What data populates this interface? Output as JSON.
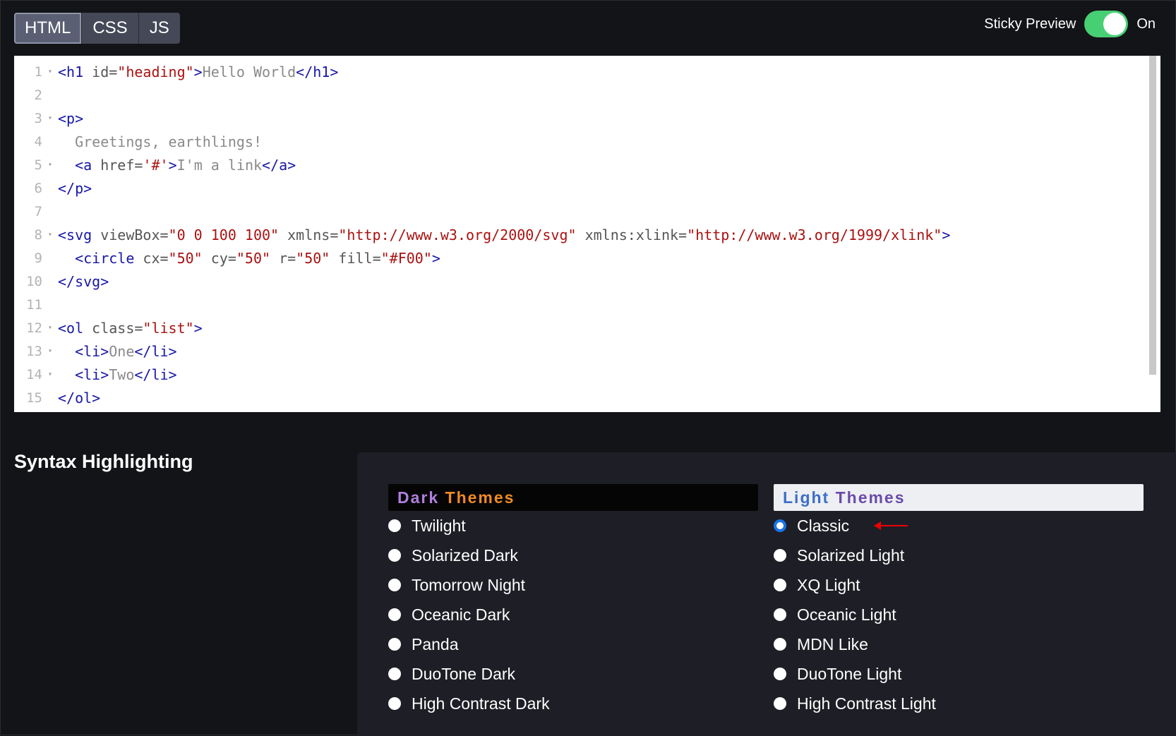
{
  "tabs": [
    "HTML",
    "CSS",
    "JS"
  ],
  "sticky_preview": {
    "label": "Sticky Preview",
    "state": "On"
  },
  "code_lines": [
    {
      "n": "1",
      "fold": "▾",
      "parts": [
        [
          "tag",
          "<h1 "
        ],
        [
          "attr",
          "id="
        ],
        [
          "str",
          "\"heading\""
        ],
        [
          "tag",
          ">"
        ],
        [
          "txt",
          "Hello World"
        ],
        [
          "tag",
          "</h1>"
        ]
      ]
    },
    {
      "n": "2",
      "fold": "",
      "parts": []
    },
    {
      "n": "3",
      "fold": "▾",
      "parts": [
        [
          "tag",
          "<p>"
        ]
      ]
    },
    {
      "n": "4",
      "fold": "",
      "parts": [
        [
          "txt",
          "  Greetings, earthlings!"
        ]
      ]
    },
    {
      "n": "5",
      "fold": "▾",
      "parts": [
        [
          "txt",
          "  "
        ],
        [
          "tag",
          "<a "
        ],
        [
          "attr",
          "href="
        ],
        [
          "str",
          "'#'"
        ],
        [
          "tag",
          ">"
        ],
        [
          "txt",
          "I'm a link"
        ],
        [
          "tag",
          "</a>"
        ]
      ]
    },
    {
      "n": "6",
      "fold": "",
      "parts": [
        [
          "tag",
          "</p>"
        ]
      ]
    },
    {
      "n": "7",
      "fold": "",
      "parts": []
    },
    {
      "n": "8",
      "fold": "▾",
      "parts": [
        [
          "tag",
          "<svg "
        ],
        [
          "attr",
          "viewBox="
        ],
        [
          "str",
          "\"0 0 100 100\""
        ],
        [
          "attr",
          " xmlns="
        ],
        [
          "str",
          "\"http://www.w3.org/2000/svg\""
        ],
        [
          "attr",
          " xmlns:xlink="
        ],
        [
          "str",
          "\"http://www.w3.org/1999/xlink\""
        ],
        [
          "tag",
          ">"
        ]
      ]
    },
    {
      "n": "9",
      "fold": "",
      "parts": [
        [
          "txt",
          "  "
        ],
        [
          "tag",
          "<circle "
        ],
        [
          "attr",
          "cx="
        ],
        [
          "str",
          "\"50\""
        ],
        [
          "attr",
          " cy="
        ],
        [
          "str",
          "\"50\""
        ],
        [
          "attr",
          " r="
        ],
        [
          "str",
          "\"50\""
        ],
        [
          "attr",
          " fill="
        ],
        [
          "str",
          "\"#F00\""
        ],
        [
          "tag",
          ">"
        ]
      ]
    },
    {
      "n": "10",
      "fold": "",
      "parts": [
        [
          "tag",
          "</svg>"
        ]
      ]
    },
    {
      "n": "11",
      "fold": "",
      "parts": []
    },
    {
      "n": "12",
      "fold": "▾",
      "parts": [
        [
          "tag",
          "<ol "
        ],
        [
          "attr",
          "class="
        ],
        [
          "str",
          "\"list\""
        ],
        [
          "tag",
          ">"
        ]
      ]
    },
    {
      "n": "13",
      "fold": "▾",
      "parts": [
        [
          "txt",
          "  "
        ],
        [
          "tag",
          "<li>"
        ],
        [
          "txt",
          "One"
        ],
        [
          "tag",
          "</li>"
        ]
      ]
    },
    {
      "n": "14",
      "fold": "▾",
      "parts": [
        [
          "txt",
          "  "
        ],
        [
          "tag",
          "<li>"
        ],
        [
          "txt",
          "Two"
        ],
        [
          "tag",
          "</li>"
        ]
      ]
    },
    {
      "n": "15",
      "fold": "",
      "parts": [
        [
          "tag",
          "</ol>"
        ]
      ]
    }
  ],
  "syntax": {
    "title": "Syntax Highlighting",
    "dark": {
      "head_1": "Dark",
      "head_2": "Themes",
      "options": [
        "Twilight",
        "Solarized Dark",
        "Tomorrow Night",
        "Oceanic Dark",
        "Panda",
        "DuoTone Dark",
        "High Contrast Dark"
      ]
    },
    "light": {
      "head_1": "Light",
      "head_2": "Themes",
      "options": [
        "Classic",
        "Solarized Light",
        "XQ Light",
        "Oceanic Light",
        "MDN Like",
        "DuoTone Light",
        "High Contrast Light"
      ]
    },
    "selected": "Classic"
  },
  "colors": {
    "toggle_on": "#47cf73",
    "radio_checked": "#1a73e8",
    "annotation_arrow": "#e00000"
  },
  "icons": {
    "fold": "fold-arrow-icon",
    "annotation": "red-arrow-icon"
  }
}
